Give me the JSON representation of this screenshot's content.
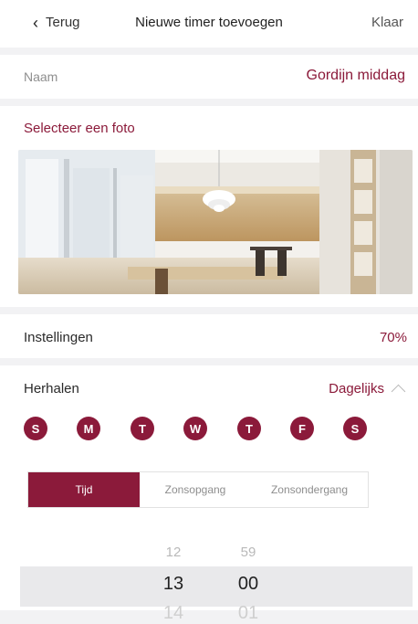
{
  "nav": {
    "back_label": "Terug",
    "title": "Nieuwe timer toevoegen",
    "done_label": "Klaar"
  },
  "name": {
    "label": "Naam",
    "value": "Gordijn middag"
  },
  "photo": {
    "select_label": "Selecteer een foto"
  },
  "settings": {
    "label": "Instellingen",
    "value": "70%"
  },
  "repeat": {
    "label": "Herhalen",
    "value": "Dagelijks",
    "days": [
      "S",
      "M",
      "T",
      "W",
      "T",
      "F",
      "S"
    ]
  },
  "mode_tabs": [
    "Tijd",
    "Zonsopgang",
    "Zonsondergang"
  ],
  "picker": {
    "hours_above": "12",
    "hours_selected": "13",
    "hours_below": "14",
    "minutes_above": "59",
    "minutes_selected": "00",
    "minutes_below": "01"
  },
  "colors": {
    "accent": "#8b1a3a"
  }
}
